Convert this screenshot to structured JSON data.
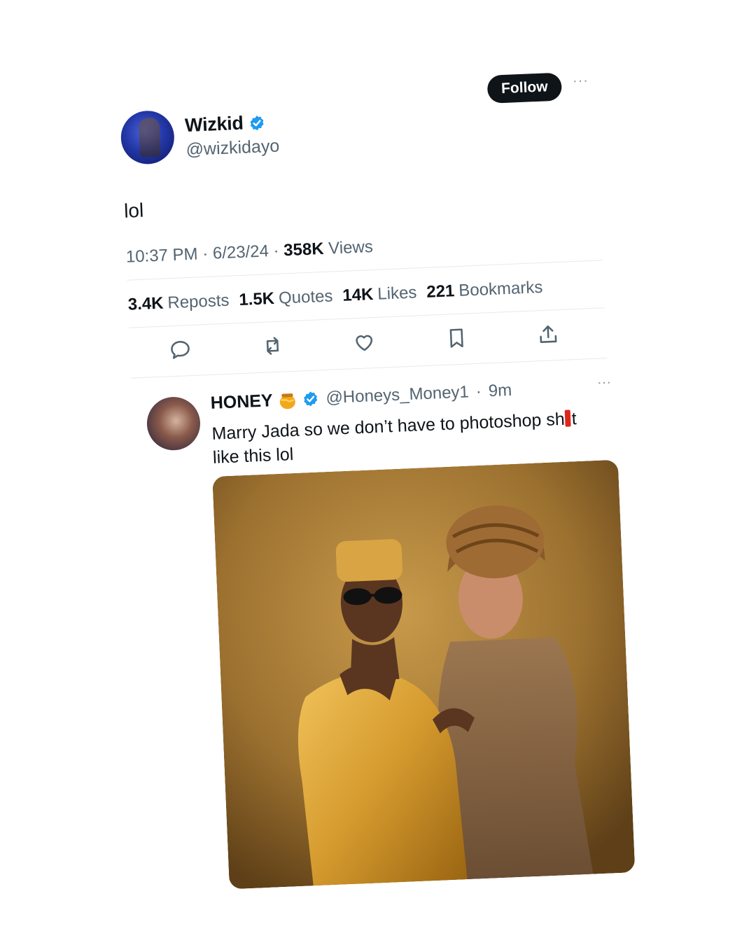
{
  "tweet": {
    "display_name": "Wizkid",
    "handle": "@wizkidayo",
    "follow_label": "Follow",
    "more_label": "···",
    "text": "lol",
    "time": "10:37 PM",
    "date": "6/23/24",
    "views_count": "358K",
    "views_label": "Views",
    "separator": "·",
    "stats": {
      "reposts_count": "3.4K",
      "reposts_label": "Reposts",
      "quotes_count": "1.5K",
      "quotes_label": "Quotes",
      "likes_count": "14K",
      "likes_label": "Likes",
      "bookmarks_count": "221",
      "bookmarks_label": "Bookmarks"
    },
    "actions": [
      "reply-icon",
      "repost-icon",
      "like-icon",
      "bookmark-icon",
      "share-icon"
    ]
  },
  "reply": {
    "display_name": "HONEY",
    "handle": "@Honeys_Money1",
    "age": "9m",
    "more_label": "···",
    "text_before": "Marry Jada so we don’t have to photoshop sh",
    "text_after": "t like this lol"
  },
  "colors": {
    "verified": "#1d9bf0",
    "text": "#0f1419",
    "muted": "#536471",
    "follow_bg": "#0f1419",
    "redaction": "#e0261c",
    "photo_bg": "#a77d36"
  }
}
